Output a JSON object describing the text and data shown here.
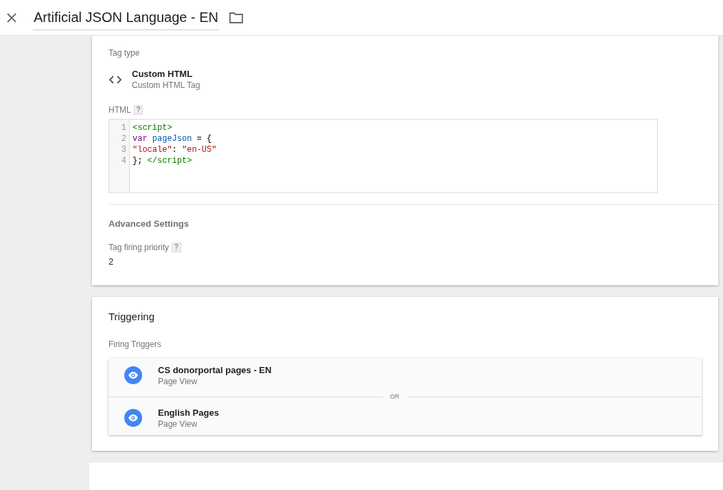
{
  "header": {
    "title": "Artificial JSON Language - EN"
  },
  "tag_config": {
    "tag_type_label": "Tag type",
    "tag_type": {
      "name": "Custom HTML",
      "description": "Custom HTML Tag"
    },
    "html_label": "HTML",
    "help": "?",
    "code_lines": [
      {
        "number": "1",
        "tokens": [
          {
            "kind": "tag",
            "text": "<script>"
          }
        ]
      },
      {
        "number": "2",
        "tokens": [
          {
            "kind": "keyword",
            "text": "var "
          },
          {
            "kind": "variable",
            "text": "pageJson"
          },
          {
            "kind": "plain",
            "text": " = {"
          }
        ]
      },
      {
        "number": "3",
        "tokens": [
          {
            "kind": "string",
            "text": "\"locale\""
          },
          {
            "kind": "plain",
            "text": ": "
          },
          {
            "kind": "string",
            "text": "\"en-US\""
          }
        ]
      },
      {
        "number": "4",
        "tokens": [
          {
            "kind": "plain",
            "text": "}; "
          },
          {
            "kind": "tag",
            "text": "</script>"
          }
        ]
      }
    ],
    "advanced_title": "Advanced Settings",
    "priority_label": "Tag firing priority",
    "priority_help": "?",
    "priority_value": "2"
  },
  "triggering": {
    "title": "Triggering",
    "firing_label": "Firing Triggers",
    "separator": "OR",
    "triggers": [
      {
        "name": "CS donorportal pages - EN",
        "type": "Page View"
      },
      {
        "name": "English Pages",
        "type": "Page View"
      }
    ]
  }
}
